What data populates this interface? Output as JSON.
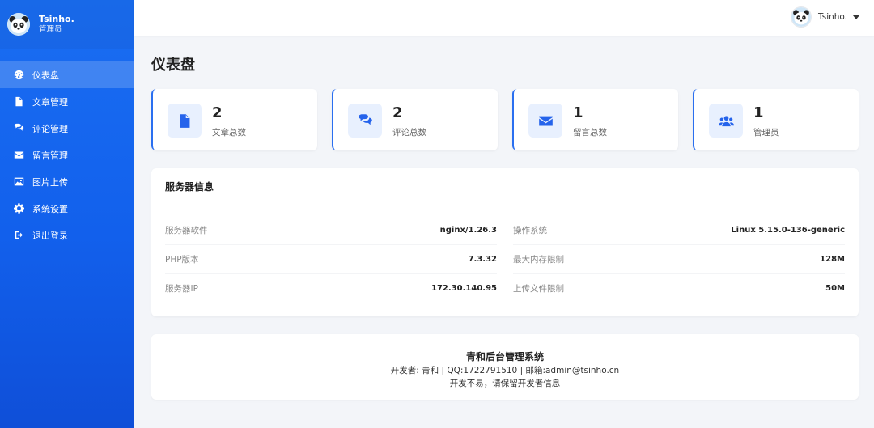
{
  "sidebar": {
    "brand": {
      "name": "Tsinho.",
      "role": "管理员"
    },
    "items": [
      {
        "label": "仪表盘",
        "icon": "dashboard-icon",
        "active": true
      },
      {
        "label": "文章管理",
        "icon": "document-icon"
      },
      {
        "label": "评论管理",
        "icon": "comments-icon"
      },
      {
        "label": "留言管理",
        "icon": "envelope-icon"
      },
      {
        "label": "图片上传",
        "icon": "image-icon"
      },
      {
        "label": "系统设置",
        "icon": "gear-icon"
      },
      {
        "label": "退出登录",
        "icon": "logout-icon"
      }
    ]
  },
  "header": {
    "user_name": "Tsinho."
  },
  "main": {
    "page_title": "仪表盘",
    "stats": [
      {
        "value": "2",
        "label": "文章总数",
        "icon": "document-icon"
      },
      {
        "value": "2",
        "label": "评论总数",
        "icon": "comments-icon"
      },
      {
        "value": "1",
        "label": "留言总数",
        "icon": "envelope-icon"
      },
      {
        "value": "1",
        "label": "管理员",
        "icon": "users-icon"
      }
    ],
    "server": {
      "title": "服务器信息",
      "rows": [
        {
          "label": "服务器软件",
          "value": "nginx/1.26.3"
        },
        {
          "label": "操作系统",
          "value": "Linux 5.15.0-136-generic"
        },
        {
          "label": "PHP版本",
          "value": "7.3.32"
        },
        {
          "label": "最大内存限制",
          "value": "128M"
        },
        {
          "label": "服务器IP",
          "value": "172.30.140.95"
        },
        {
          "label": "上传文件限制",
          "value": "50M"
        }
      ]
    },
    "footer": {
      "title": "青和后台管理系统",
      "line1": "开发者: 青和 | QQ:1722791510 | 邮箱:admin@tsinho.cn",
      "line2": "开发不易，请保留开发者信息"
    }
  },
  "colors": {
    "accent": "#1a6ef2",
    "icon_blue": "#2563eb",
    "icon_bg": "#e8f0fe"
  }
}
